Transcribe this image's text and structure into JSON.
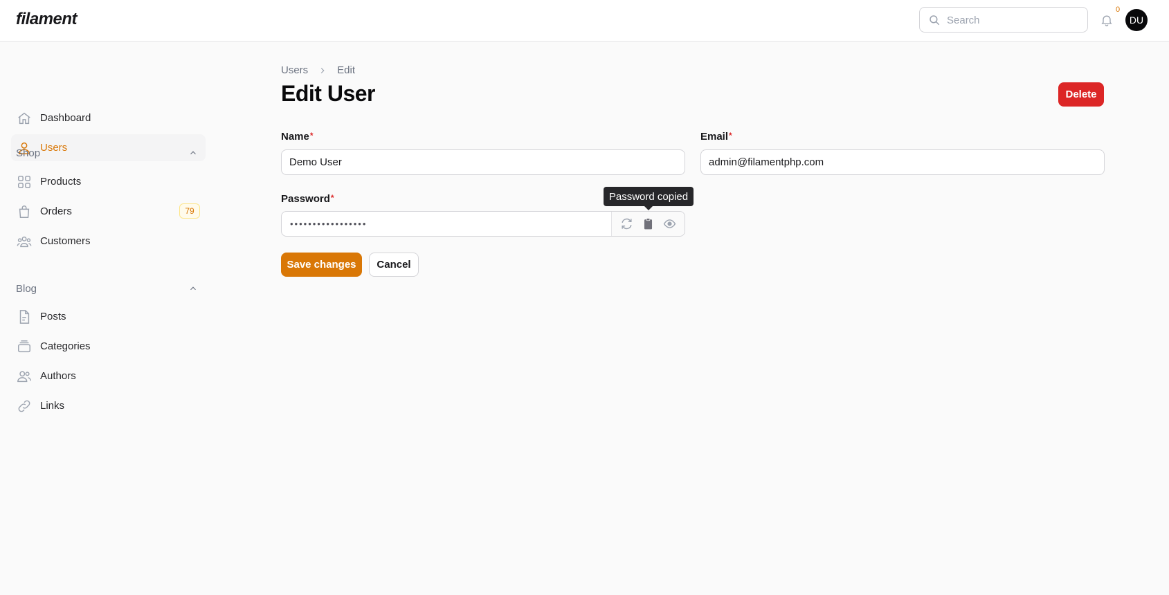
{
  "app": {
    "logo": "filament"
  },
  "header": {
    "search": {
      "placeholder": "Search"
    },
    "notifications": {
      "count": "0",
      "icon": "bell-icon"
    },
    "user": {
      "initials": "DU"
    }
  },
  "sidebar": {
    "items": [
      {
        "label": "Dashboard",
        "icon": "home-icon"
      },
      {
        "label": "Users",
        "icon": "user-icon",
        "active": true
      }
    ],
    "groups": [
      {
        "label": "Shop",
        "items": [
          {
            "label": "Products",
            "icon": "grid-icon"
          },
          {
            "label": "Orders",
            "icon": "shopping-bag-icon",
            "badge": "79"
          },
          {
            "label": "Customers",
            "icon": "user-group-icon"
          }
        ]
      },
      {
        "label": "Blog",
        "items": [
          {
            "label": "Posts",
            "icon": "document-icon"
          },
          {
            "label": "Categories",
            "icon": "folder-icon"
          },
          {
            "label": "Authors",
            "icon": "users-icon"
          },
          {
            "label": "Links",
            "icon": "link-icon"
          }
        ]
      }
    ]
  },
  "main": {
    "breadcrumbs": [
      "Users",
      "Edit"
    ],
    "title": "Edit User",
    "delete_label": "Delete",
    "form": {
      "name": {
        "label": "Name",
        "value": "Demo User",
        "required_mark": "*"
      },
      "email": {
        "label": "Email",
        "value": "admin@filamentphp.com",
        "required_mark": "*"
      },
      "password": {
        "label": "Password",
        "masked_value": "•••••••••••••••••",
        "required_mark": "*"
      }
    },
    "tooltip": "Password copied",
    "save_label": "Save changes",
    "cancel_label": "Cancel"
  },
  "colors": {
    "primary": "#d97706",
    "danger": "#dc2626",
    "sidebar_active_bg": "#f4f4f5"
  }
}
